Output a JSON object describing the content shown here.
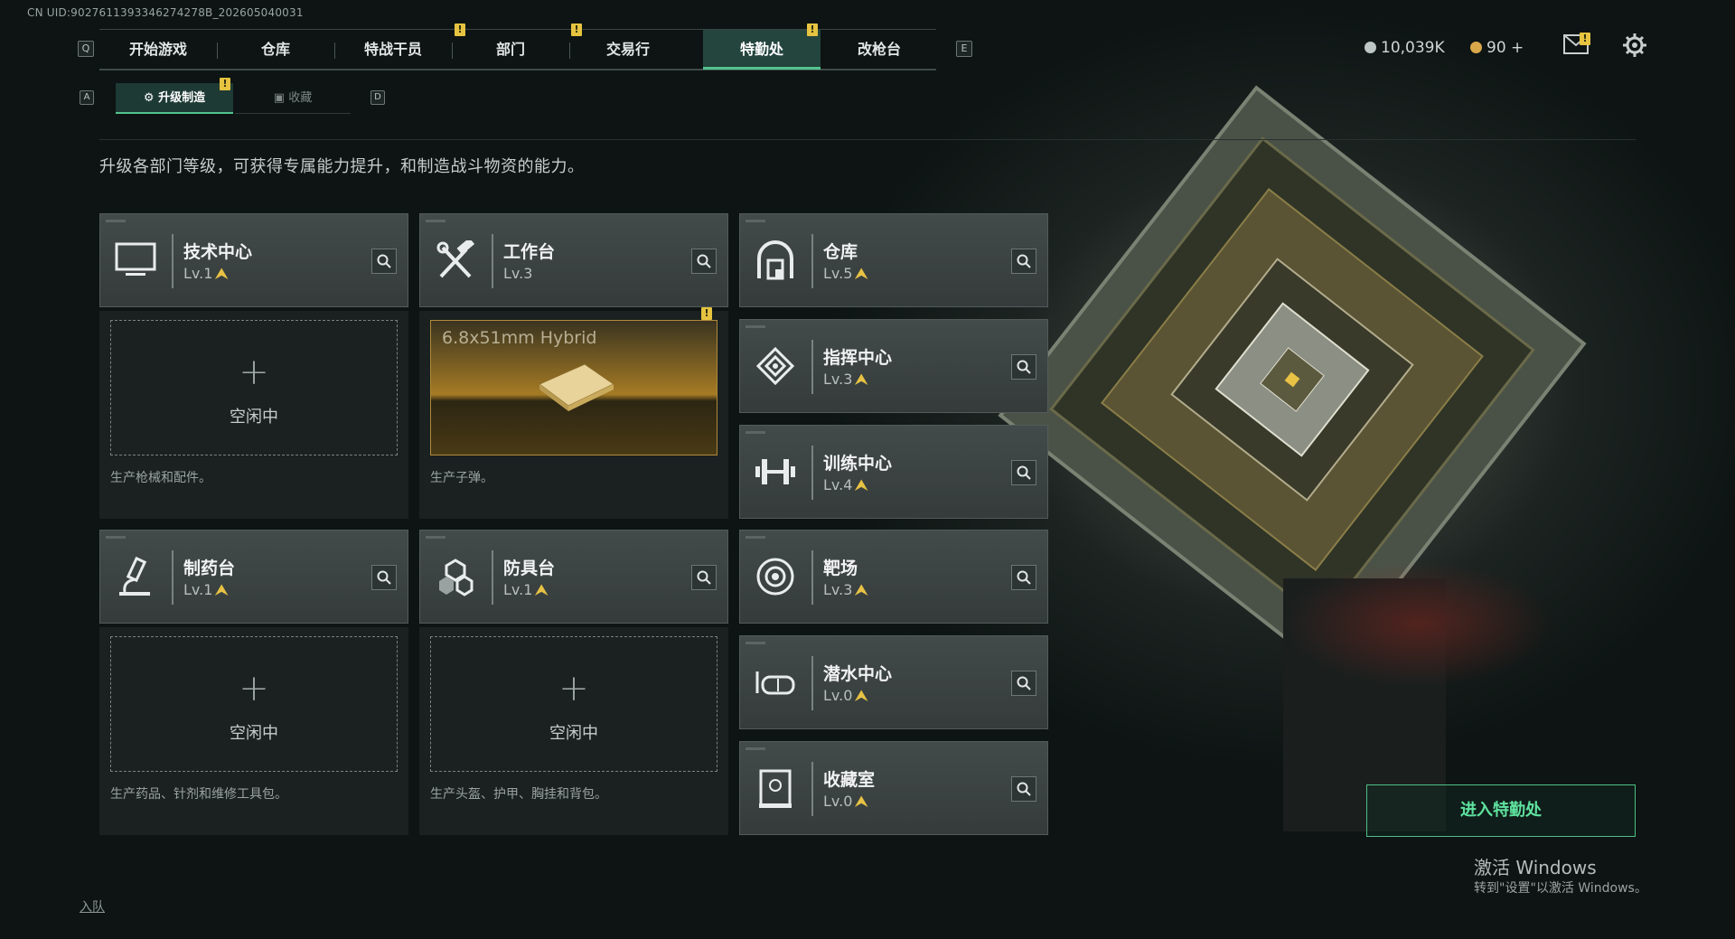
{
  "uid": "CN UID:9027611393346274278B_202605040031",
  "nav": {
    "left_key": "Q",
    "right_key": "E",
    "items": [
      {
        "label": "开始游戏",
        "notif": ""
      },
      {
        "label": "仓库",
        "notif": ""
      },
      {
        "label": "特战干员",
        "notif": "!"
      },
      {
        "label": "部门",
        "notif": "!"
      },
      {
        "label": "交易行",
        "notif": ""
      },
      {
        "label": "特勤处",
        "notif": "!"
      },
      {
        "label": "改枪台",
        "notif": ""
      }
    ]
  },
  "currency": {
    "coins": "10,039K",
    "tokens": "90",
    "plus": "+"
  },
  "subtabs": {
    "left_key": "A",
    "right_key": "D",
    "upgrade": "升级制造",
    "collection": "收藏",
    "notif": "!"
  },
  "description": "升级各部门等级，可获得专属能力提升，和制造战斗物资的能力。",
  "stations": {
    "tech": {
      "name": "技术中心",
      "level": "Lv.1"
    },
    "workbench": {
      "name": "工作台",
      "level": "Lv.3"
    },
    "pharmacy": {
      "name": "制药台",
      "level": "Lv.1"
    },
    "armor": {
      "name": "防具台",
      "level": "Lv.1"
    },
    "storage": {
      "name": "仓库",
      "level": "Lv.5"
    },
    "command": {
      "name": "指挥中心",
      "level": "Lv.3"
    },
    "training": {
      "name": "训练中心",
      "level": "Lv.4"
    },
    "range": {
      "name": "靶场",
      "level": "Lv.3"
    },
    "diving": {
      "name": "潜水中心",
      "level": "Lv.0"
    },
    "collection": {
      "name": "收藏室",
      "level": "Lv.0"
    }
  },
  "panels": {
    "idle_label": "空闲中",
    "plus": "+",
    "tech_desc": "生产枪械和配件。",
    "workbench_desc": "生产子弹。",
    "workbench_product": "6.8x51mm Hybrid",
    "workbench_notif": "!",
    "pharmacy_desc": "生产药品、针剂和维修工具包。",
    "armor_desc": "生产头盔、护甲、胸挂和背包。"
  },
  "upgrade_arrow": "⮝",
  "enter_button": "进入特勤处",
  "windows": {
    "line1": "激活 Windows",
    "line2": "转到\"设置\"以激活 Windows。"
  },
  "team_link": "入队",
  "icons": [
    "monitor-icon",
    "hammer-wrench-icon",
    "flask-icon",
    "armor-plates-icon",
    "vault-icon",
    "command-target-icon",
    "dumbbell-icon",
    "target-range-icon",
    "diving-mask-icon",
    "collection-box-icon",
    "search-icon",
    "mail-icon",
    "gear-icon"
  ],
  "colors": {
    "accent": "#53c38e",
    "upgrade": "#e7c244",
    "notif": "#e6c340"
  }
}
